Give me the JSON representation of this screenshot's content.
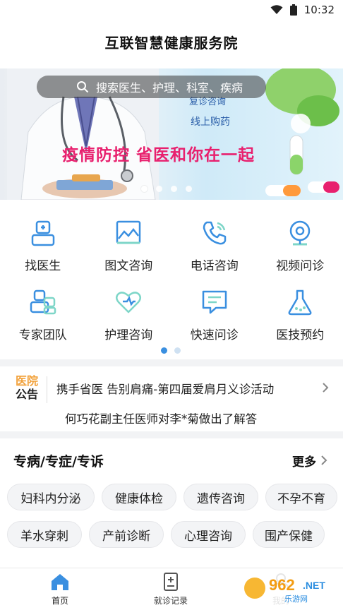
{
  "status_bar": {
    "time": "10:32"
  },
  "app": {
    "title": "互联智慧健康服务院"
  },
  "banner": {
    "search_placeholder": "搜索医生、护理、科室、疾病",
    "line1": "复诊咨询",
    "line2": "线上购药",
    "slogan": "疫情防控  省医和你在一起",
    "slide_count": 4,
    "active_slide": 0
  },
  "grid": {
    "items": [
      {
        "label": "找医生",
        "icon": "doctor-icon"
      },
      {
        "label": "图文咨询",
        "icon": "image-chat-icon"
      },
      {
        "label": "电话咨询",
        "icon": "phone-icon"
      },
      {
        "label": "视频问诊",
        "icon": "camera-icon"
      },
      {
        "label": "专家团队",
        "icon": "team-icon"
      },
      {
        "label": "护理咨询",
        "icon": "heart-care-icon"
      },
      {
        "label": "快速问诊",
        "icon": "message-icon"
      },
      {
        "label": "医技预约",
        "icon": "flask-icon"
      }
    ],
    "page_count": 2,
    "active_page": 0
  },
  "notice": {
    "badge_top": "医院",
    "badge_bottom": "公告",
    "line1": "携手省医 告别肩痛-第四届爱肩月义诊活动",
    "line2": "何巧花副主任医师对李*菊做出了解答"
  },
  "specialty": {
    "title": "专病/专症/专诉",
    "more": "更多",
    "row1": [
      "妇科内分泌",
      "健康体检",
      "遗传咨询",
      "不孕不育"
    ],
    "row2": [
      "羊水穿刺",
      "产前诊断",
      "心理咨询",
      "围产保健"
    ]
  },
  "tabbar": {
    "home": "首页",
    "records": "就诊记录",
    "mine": "我的"
  },
  "colors": {
    "accent": "#3a8fe0",
    "slogan": "#e8206e",
    "notice_badge": "#f2a13a",
    "icon_blue": "#3a8fe0"
  }
}
